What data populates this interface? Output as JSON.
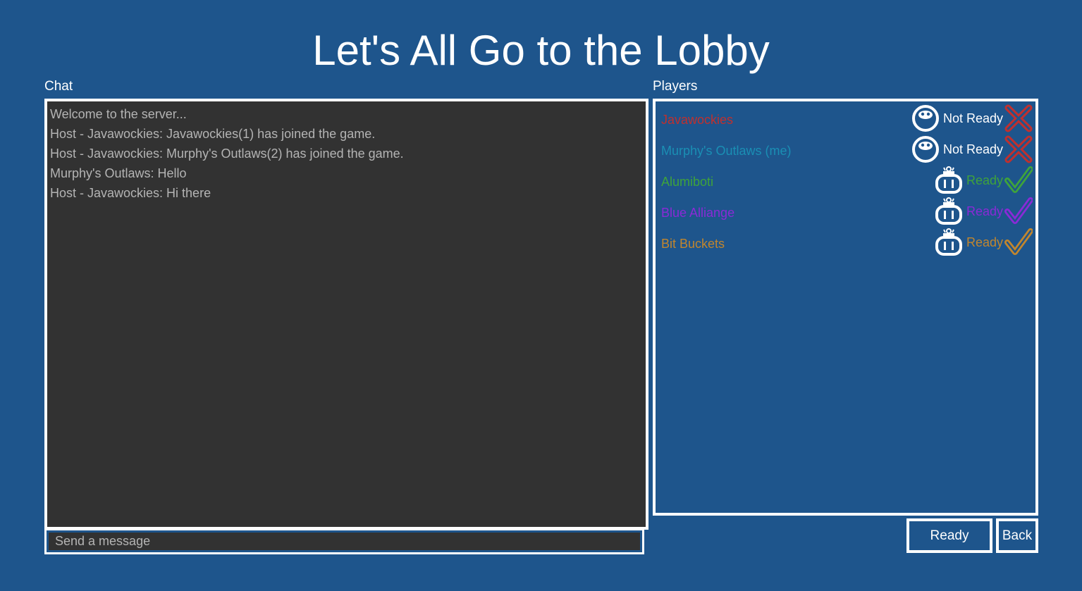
{
  "title": "Let's All Go to the Lobby",
  "chat": {
    "label": "Chat",
    "messages": [
      "Welcome to the server...",
      "Host - Javawockies: Javawockies(1) has joined the game.",
      "Host - Javawockies: Murphy's Outlaws(2) has joined the game.",
      "Murphy's Outlaws: Hello",
      "Host - Javawockies: Hi there"
    ],
    "input_placeholder": "Send a message"
  },
  "players": {
    "label": "Players",
    "list": [
      {
        "name": "Javawockies",
        "color": "#c0302e",
        "type": "human-icon",
        "status": "Not Ready",
        "status_color": "#ffffff",
        "status_icon": "x-icon",
        "status_icon_color": "#c0302e"
      },
      {
        "name": "Murphy's Outlaws (me)",
        "color": "#1a8fb4",
        "type": "human-icon",
        "status": "Not Ready",
        "status_color": "#ffffff",
        "status_icon": "x-icon",
        "status_icon_color": "#c0302e"
      },
      {
        "name": "Alumiboti",
        "color": "#3fa33b",
        "type": "robot-icon",
        "status": "Ready",
        "status_color": "#3fa33b",
        "status_icon": "check-icon",
        "status_icon_color": "#3fa33b"
      },
      {
        "name": "Blue Alliange",
        "color": "#8a2ad6",
        "type": "robot-icon",
        "status": "Ready",
        "status_color": "#8a2ad6",
        "status_icon": "check-icon",
        "status_icon_color": "#8a2ad6"
      },
      {
        "name": "Bit Buckets",
        "color": "#c1862e",
        "type": "robot-icon",
        "status": "Ready",
        "status_color": "#c1862e",
        "status_icon": "check-icon",
        "status_icon_color": "#c1862e"
      }
    ]
  },
  "buttons": {
    "ready": "Ready",
    "back": "Back"
  }
}
